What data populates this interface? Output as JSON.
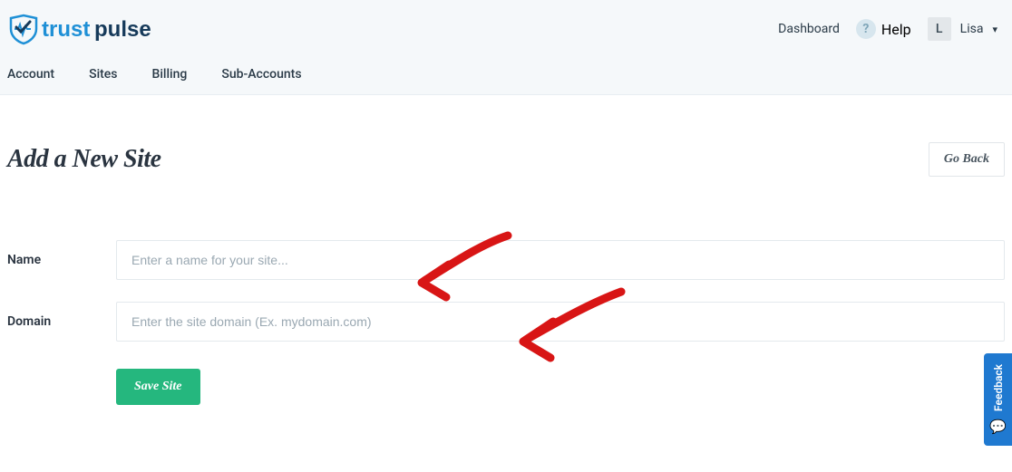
{
  "header": {
    "brand_part1": "trust",
    "brand_part2": "pulse",
    "dashboard_label": "Dashboard",
    "help_label": "Help",
    "user_initial": "L",
    "user_name": "Lisa"
  },
  "nav": {
    "tabs": [
      {
        "label": "Account"
      },
      {
        "label": "Sites"
      },
      {
        "label": "Billing"
      },
      {
        "label": "Sub-Accounts"
      }
    ]
  },
  "page": {
    "title": "Add a New Site",
    "go_back_label": "Go Back"
  },
  "form": {
    "name_label": "Name",
    "name_placeholder": "Enter a name for your site...",
    "name_value": "",
    "domain_label": "Domain",
    "domain_placeholder": "Enter the site domain (Ex. mydomain.com)",
    "domain_value": "",
    "save_label": "Save Site"
  },
  "feedback": {
    "label": "Feedback"
  }
}
